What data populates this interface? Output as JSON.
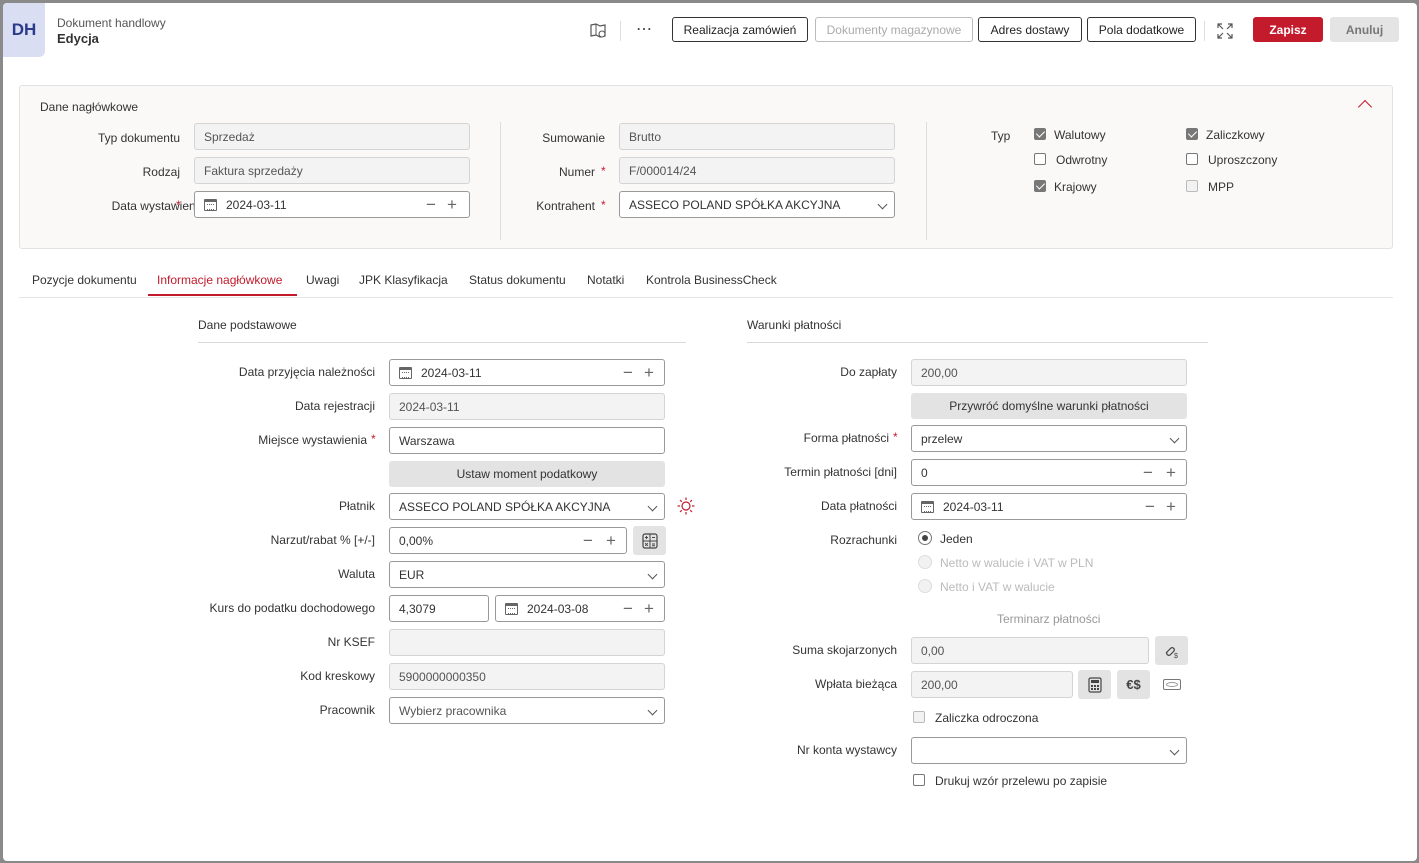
{
  "header": {
    "logo": "DH",
    "subtitle": "Dokument handlowy",
    "title": "Edycja",
    "buttons": {
      "realizacja": "Realizacja zamówień",
      "magazynowe": "Dokumenty magazynowe",
      "adres": "Adres dostawy",
      "pola": "Pola dodatkowe",
      "save": "Zapisz",
      "cancel": "Anuluj"
    },
    "icons": [
      "map-book-icon",
      "more-icon",
      "expand-icon"
    ]
  },
  "section": {
    "title": "Dane nagłówkowe",
    "typ_dokumentu_label": "Typ dokumentu",
    "typ_dokumentu": "Sprzedaż",
    "rodzaj_label": "Rodzaj",
    "rodzaj": "Faktura sprzedaży",
    "data_wystawienia_label": "Data wystawienia",
    "data_wystawienia": "2024-03-11",
    "sumowanie_label": "Sumowanie",
    "sumowanie": "Brutto",
    "numer_label": "Numer",
    "numer": "F/000014/24",
    "kontrahent_label": "Kontrahent",
    "kontrahent": "ASSECO POLAND SPÓŁKA AKCYJNA",
    "typ_label": "Typ",
    "checkboxes": {
      "walutowy": "Walutowy",
      "zaliczkowy": "Zaliczkowy",
      "odwrotny": "Odwrotny",
      "uproszczony": "Uproszczony",
      "krajowy": "Krajowy",
      "mpp": "MPP"
    },
    "checked": {
      "walutowy": true,
      "zaliczkowy": true,
      "odwrotny": false,
      "uproszczony": false,
      "krajowy": true,
      "mpp": false
    }
  },
  "tabs": [
    "Pozycje dokumentu",
    "Informacje nagłówkowe",
    "Uwagi",
    "JPK Klasyfikacja",
    "Status dokumentu",
    "Notatki",
    "Kontrola BusinessCheck"
  ],
  "active_tab": "Informacje nagłówkowe",
  "basic": {
    "title": "Dane podstawowe",
    "data_przyjecia_label": "Data przyjęcia należności",
    "data_przyjecia": "2024-03-11",
    "data_rejestracji_label": "Data rejestracji",
    "data_rejestracji": "2024-03-11",
    "miejsce_label": "Miejsce wystawienia",
    "miejsce": "Warszawa",
    "moment_button": "Ustaw moment podatkowy",
    "platnik_label": "Płatnik",
    "platnik": "ASSECO POLAND SPÓŁKA AKCYJNA",
    "narzut_label": "Narzut/rabat % [+/-]",
    "narzut": "0,00%",
    "waluta_label": "Waluta",
    "waluta": "EUR",
    "kurs_label": "Kurs do podatku dochodowego",
    "kurs": "4,3079",
    "kurs_data": "2024-03-08",
    "ksef_label": "Nr KSEF",
    "ksef": "",
    "kod_label": "Kod kreskowy",
    "kod": "5900000000350",
    "pracownik_label": "Pracownik",
    "pracownik_placeholder": "Wybierz pracownika"
  },
  "payment": {
    "title": "Warunki płatności",
    "do_zaplaty_label": "Do zapłaty",
    "do_zaplaty": "200,00",
    "restore_button": "Przywróć domyślne warunki płatności",
    "forma_label": "Forma płatności",
    "forma": "przelew",
    "termin_label": "Termin płatności [dni]",
    "termin": "0",
    "data_label": "Data płatności",
    "data": "2024-03-11",
    "rozrachunki_label": "Rozrachunki",
    "rozrachunki_options": [
      "Jeden",
      "Netto w walucie i VAT w PLN",
      "Netto i VAT w walucie"
    ],
    "terminarz": "Terminarz płatności",
    "suma_label": "Suma skojarzonych",
    "suma": "0,00",
    "wplata_label": "Wpłata bieżąca",
    "wplata": "200,00",
    "zaliczka_label": "Zaliczka odroczona",
    "konto_label": "Nr konta wystawcy",
    "konto": "",
    "drukuj_label": "Drukuj wzór przelewu po zapisie"
  }
}
